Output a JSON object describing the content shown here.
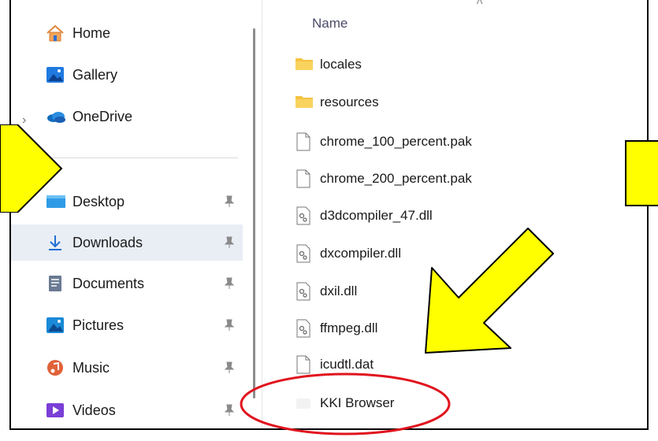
{
  "sidebar": {
    "items": [
      {
        "label": "Home",
        "icon": "home-icon"
      },
      {
        "label": "Gallery",
        "icon": "gallery-icon"
      },
      {
        "label": "OneDrive",
        "icon": "onedrive-cloud-icon"
      },
      {
        "label": "Desktop",
        "icon": "desktop-icon",
        "pinned": true
      },
      {
        "label": "Downloads",
        "icon": "download-arrow-icon",
        "pinned": true,
        "selected": true
      },
      {
        "label": "Documents",
        "icon": "documents-icon",
        "pinned": true
      },
      {
        "label": "Pictures",
        "icon": "pictures-icon",
        "pinned": true
      },
      {
        "label": "Music",
        "icon": "music-icon",
        "pinned": true
      },
      {
        "label": "Videos",
        "icon": "videos-icon",
        "pinned": true
      }
    ]
  },
  "file_list": {
    "column_header": "Name",
    "files": [
      {
        "name": "locales",
        "type": "folder"
      },
      {
        "name": "resources",
        "type": "folder"
      },
      {
        "name": "chrome_100_percent.pak",
        "type": "file"
      },
      {
        "name": "chrome_200_percent.pak",
        "type": "file"
      },
      {
        "name": "d3dcompiler_47.dll",
        "type": "dll"
      },
      {
        "name": "dxcompiler.dll",
        "type": "dll"
      },
      {
        "name": "dxil.dll",
        "type": "dll"
      },
      {
        "name": "ffmpeg.dll",
        "type": "dll"
      },
      {
        "name": "icudtl.dat",
        "type": "file"
      },
      {
        "name": "KKI Browser",
        "type": "application"
      }
    ]
  },
  "annotations": {
    "arrow_color": "#ffff00",
    "highlight_circle_color": "#e0141e"
  }
}
